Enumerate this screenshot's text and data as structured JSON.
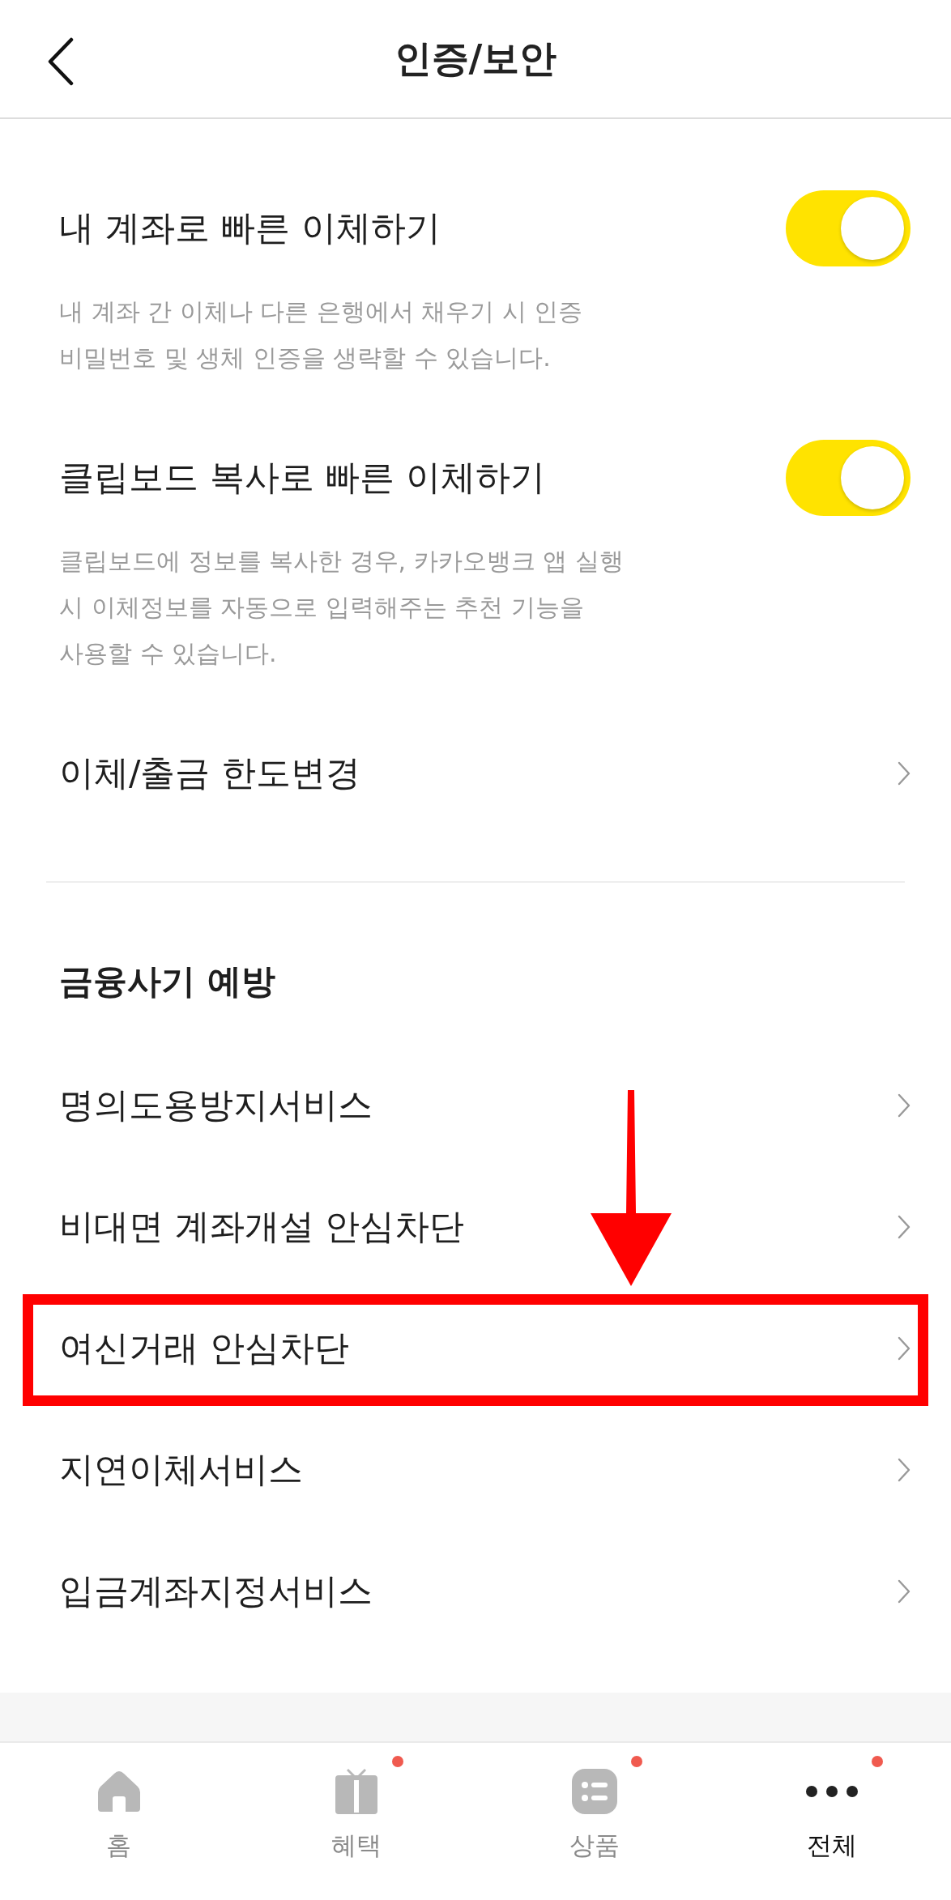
{
  "header": {
    "title": "인증/보안"
  },
  "transfer_settings": [
    {
      "kind": "toggle",
      "label": "내 계좌로 빠른 이체하기",
      "on": true,
      "description": [
        "내 계좌 간 이체나 다른 은행에서 채우기 시 인증",
        "비밀번호 및 생체 인증을 생략할 수 있습니다."
      ]
    },
    {
      "kind": "toggle",
      "label": "클립보드 복사로 빠른 이체하기",
      "on": true,
      "description": [
        "클립보드에 정보를 복사한 경우, 카카오뱅크 앱 실행",
        "시 이체정보를 자동으로 입력해주는 추천 기능을",
        "사용할 수 있습니다."
      ]
    },
    {
      "kind": "link",
      "label": "이체/출금 한도변경"
    }
  ],
  "fraud_prevention": {
    "title": "금융사기 예방",
    "items": [
      {
        "label": "명의도용방지서비스",
        "highlighted": false
      },
      {
        "label": "비대면 계좌개설 안심차단",
        "highlighted": false
      },
      {
        "label": "여신거래 안심차단",
        "highlighted": true
      },
      {
        "label": "지연이체서비스",
        "highlighted": false
      },
      {
        "label": "입금계좌지정서비스",
        "highlighted": false
      }
    ]
  },
  "bottom_nav": [
    {
      "kind": "home",
      "label": "홈",
      "selected": false,
      "badge": false
    },
    {
      "kind": "gift",
      "label": "혜택",
      "selected": false,
      "badge": true
    },
    {
      "kind": "products",
      "label": "상품",
      "selected": false,
      "badge": true
    },
    {
      "kind": "more",
      "label": "전체",
      "selected": true,
      "badge": true
    }
  ]
}
